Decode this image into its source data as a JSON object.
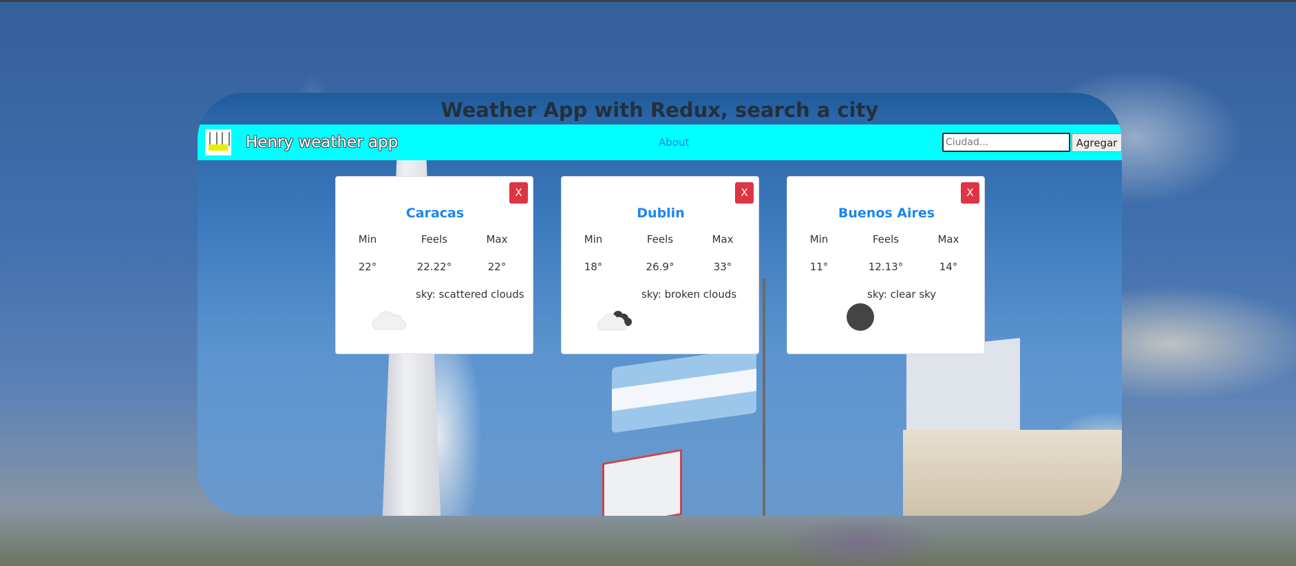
{
  "page": {
    "title": "Weather App with Redux, search a city"
  },
  "navbar": {
    "brand": "Henry weather app",
    "about_link": "About",
    "search": {
      "placeholder": "Ciudad...",
      "value": ""
    },
    "add_button": "Agregar"
  },
  "cards": [
    {
      "city": "Caracas",
      "close_label": "X",
      "min_label": "Min",
      "feels_label": "Feels",
      "max_label": "Max",
      "min": "22°",
      "feels": "22.22°",
      "max": "22°",
      "sky": "sky: scattered clouds",
      "icon": "scattered-clouds-icon"
    },
    {
      "city": "Dublin",
      "close_label": "X",
      "min_label": "Min",
      "feels_label": "Feels",
      "max_label": "Max",
      "min": "18°",
      "feels": "26.9°",
      "max": "33°",
      "sky": "sky: broken clouds",
      "icon": "broken-clouds-icon"
    },
    {
      "city": "Buenos Aires",
      "close_label": "X",
      "min_label": "Min",
      "feels_label": "Feels",
      "max_label": "Max",
      "min": "11°",
      "feels": "12.13°",
      "max": "14°",
      "sky": "sky: clear sky",
      "icon": "clear-sky-icon"
    }
  ],
  "colors": {
    "navbar": "#00ffff",
    "city_link": "#1a86f0",
    "close_button": "#dc3545",
    "title_text": "#23303b"
  }
}
